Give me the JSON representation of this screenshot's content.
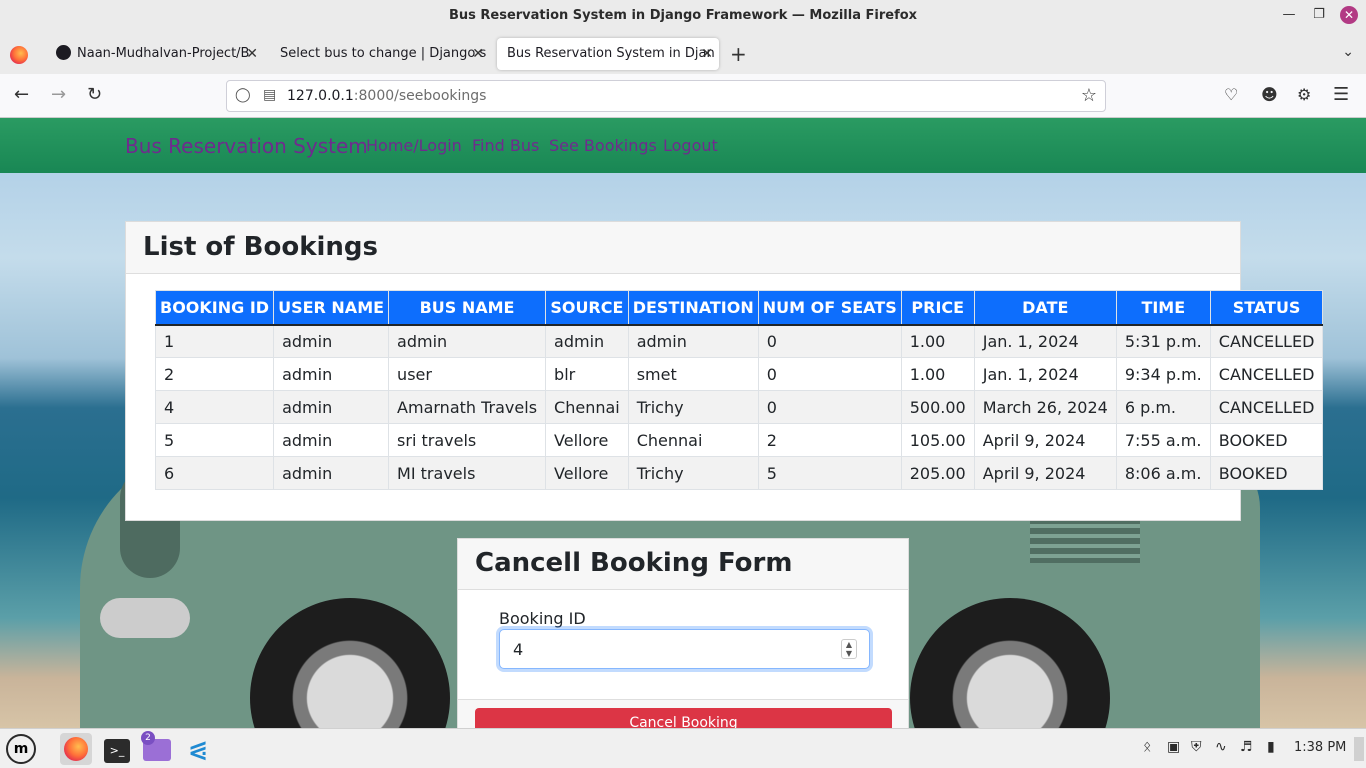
{
  "window": {
    "title": "Bus Reservation System in Django Framework — Mozilla Firefox"
  },
  "tabs": [
    {
      "label": "Naan-Mudhalvan-Project/B"
    },
    {
      "label": "Select bus to change | Django s"
    },
    {
      "label": "Bus Reservation System in Djan"
    }
  ],
  "url": {
    "host": "127.0.0.1",
    "rest": ":8000/seebookings"
  },
  "site": {
    "brand": "Bus Reservation System",
    "nav": [
      "Home/Login",
      "Find Bus",
      "See Bookings",
      "Logout"
    ]
  },
  "bookings": {
    "title": "List of Bookings",
    "columns": [
      "BOOKING ID",
      "USER NAME",
      "BUS NAME",
      "SOURCE",
      "DESTINATION",
      "NUM OF SEATS",
      "PRICE",
      "DATE",
      "TIME",
      "STATUS"
    ],
    "rows": [
      [
        "1",
        "admin",
        "admin",
        "admin",
        "admin",
        "0",
        "1.00",
        "Jan. 1, 2024",
        "5:31 p.m.",
        "CANCELLED"
      ],
      [
        "2",
        "admin",
        "user",
        "blr",
        "smet",
        "0",
        "1.00",
        "Jan. 1, 2024",
        "9:34 p.m.",
        "CANCELLED"
      ],
      [
        "4",
        "admin",
        "Amarnath Travels",
        "Chennai",
        "Trichy",
        "0",
        "500.00",
        "March 26, 2024",
        "6 p.m.",
        "CANCELLED"
      ],
      [
        "5",
        "admin",
        "sri travels",
        "Vellore",
        "Chennai",
        "2",
        "105.00",
        "April 9, 2024",
        "7:55 a.m.",
        "BOOKED"
      ],
      [
        "6",
        "admin",
        "MI travels",
        "Vellore",
        "Trichy",
        "5",
        "205.00",
        "April 9, 2024",
        "8:06 a.m.",
        "BOOKED"
      ]
    ]
  },
  "cancel_form": {
    "title": "Cancell Booking Form",
    "label": "Booking ID",
    "value": "4",
    "button": "Cancel Booking"
  },
  "taskbar": {
    "clock": "1:38 PM",
    "files_badge": "2"
  },
  "colors": {
    "nav_green": "#198754",
    "table_header": "#0d6efd",
    "danger": "#dc3545",
    "brand_text": "#6f2b8e"
  }
}
